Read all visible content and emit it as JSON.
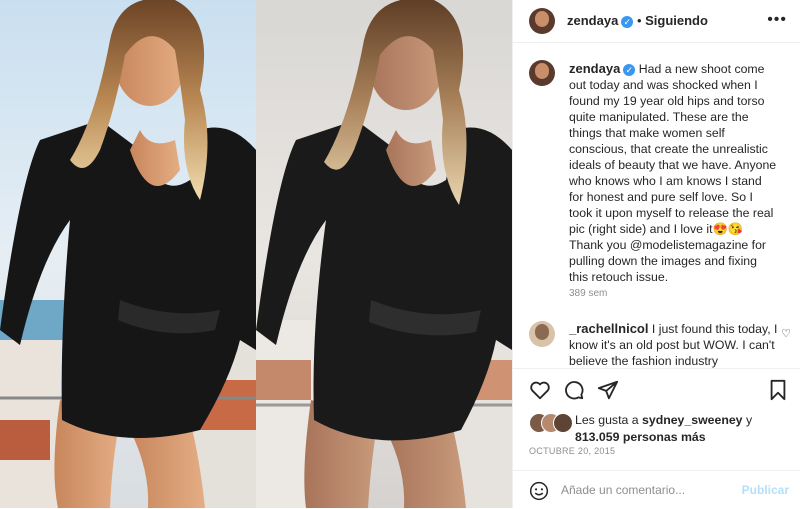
{
  "post": {
    "username": "zendaya",
    "follow_status": "Siguiendo",
    "caption": "Had a new shoot come out today and was shocked when I found my 19 year old hips and torso quite manipulated. These are the things that make women self conscious, that create the unrealistic ideals of beauty that we have. Anyone who knows who I am knows I stand for honest and pure self love. So I took it upon myself to release the real pic (right side) and I love it😍😘 Thank you @modelistemagazine for pulling down the images and fixing this retouch issue.",
    "caption_time": "389 sem",
    "date": "OCTUBRE 20, 2015"
  },
  "comment": {
    "username": "_rachellnicol",
    "text": "I just found this today, I know it's an old post but WOW. I can't believe the fashion industry"
  },
  "likes": {
    "prefix": "Les gusta a",
    "user": "sydney_sweeney",
    "connector": "y",
    "count": "813.059",
    "suffix": "personas más"
  },
  "comment_box": {
    "placeholder": "Añade un comentario...",
    "publish_label": "Publicar"
  },
  "icons": {
    "more": "more-dots-icon",
    "like": "heart-icon",
    "comment": "comment-icon",
    "share": "share-icon",
    "save": "bookmark-icon",
    "emoji": "smiley-icon",
    "verified": "verified-badge-icon"
  },
  "colors": {
    "verified": "#3897f0",
    "publish_disabled": "#b2dffc",
    "muted_text": "#8e8e8e"
  }
}
